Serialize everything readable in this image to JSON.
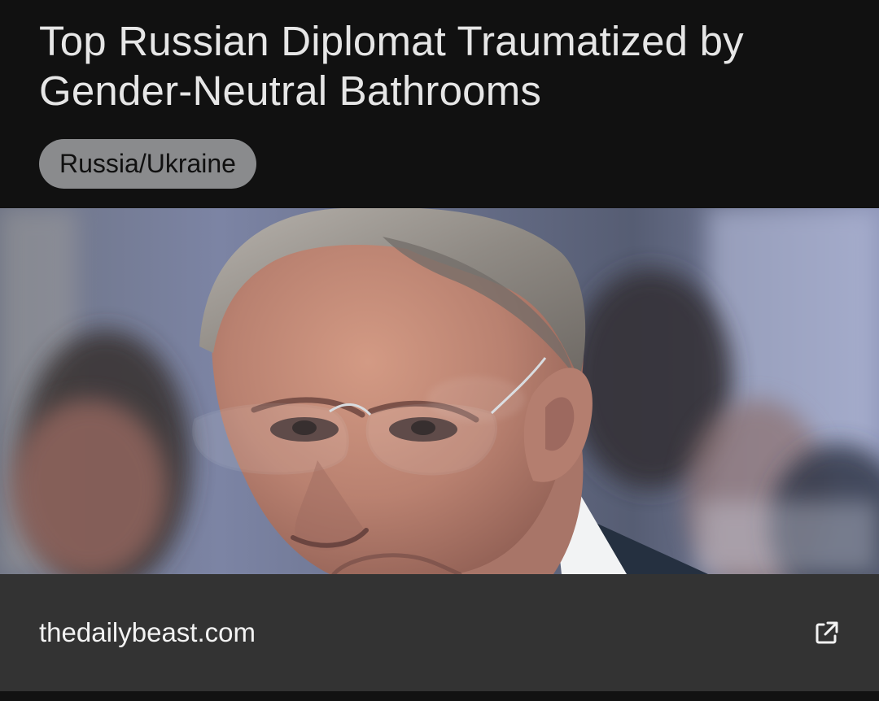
{
  "article": {
    "title": "Top Russian Diplomat Traumatized by Gender-Neutral Bathrooms",
    "tag": "Russia/Ukraine",
    "source_domain": "thedailybeast.com"
  },
  "icons": {
    "external_link": "external-link-icon"
  },
  "colors": {
    "background": "#111111",
    "title_text": "#e6e6e6",
    "tag_background": "#8a8b8d",
    "tag_text": "#101010",
    "footer_background": "#333333",
    "footer_text": "#f2f2f2"
  }
}
